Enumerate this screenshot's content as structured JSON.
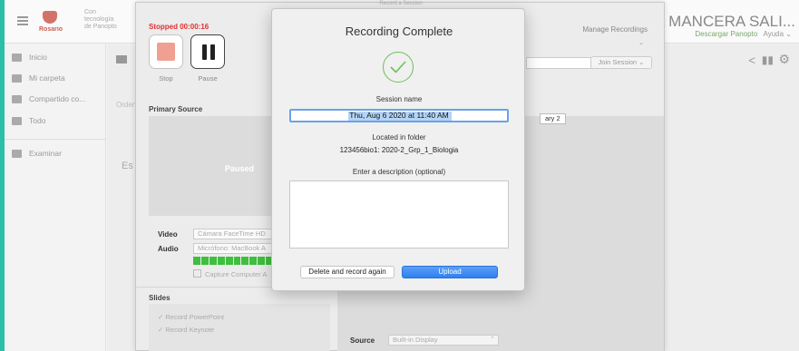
{
  "browser": {
    "logo_text": "Rosario",
    "tagline": "Con tecnología de Panopto",
    "user_name": "INA MANCERA SALI...",
    "user_download": "Descargar Panopto",
    "user_help": "Ayuda"
  },
  "sidebar": {
    "items": [
      {
        "label": "Inicio",
        "icon": "home-icon"
      },
      {
        "label": "Mi carpeta",
        "icon": "folder-icon"
      },
      {
        "label": "Compartido co...",
        "icon": "share-icon"
      },
      {
        "label": "Todo",
        "icon": "list-icon"
      },
      {
        "label": "Examinar",
        "icon": "folder-outline-icon"
      }
    ]
  },
  "content": {
    "orden_label": "Orden",
    "est_label": "Es"
  },
  "recorder": {
    "window_title": "Record a Session",
    "status": "Stopped  00:00:16",
    "stop_label": "Stop",
    "pause_label": "Pause",
    "manage_recordings": "Manage Recordings",
    "join_session": "Join Session",
    "primary_source_label": "Primary Source",
    "preview_status": "Paused",
    "video_label": "Video",
    "video_value": "Cámara FaceTime HD",
    "audio_label": "Audio",
    "audio_value": "Micrófono: MacBook A",
    "capture_audio": "Capture Computer A",
    "slides_label": "Slides",
    "slides_options": [
      "Record PowerPoint",
      "Record Keynote"
    ],
    "secondary_label": "ary 2",
    "source_label": "Source",
    "source_value": "Built-in Display",
    "audio_level": 0.95
  },
  "modal": {
    "title": "Recording Complete",
    "session_name_label": "Session name",
    "session_name_value": "Thu, Aug 6 2020 at 11:40 AM",
    "located_label": "Located in folder",
    "folder_value": "123456bio1: 2020-2_Grp_1_Biologia",
    "description_label": "Enter a description (optional)",
    "description_value": "",
    "delete_button": "Delete and record again",
    "upload_button": "Upload",
    "success_color": "#6cbf5a",
    "accent_color": "#2f7fee"
  }
}
